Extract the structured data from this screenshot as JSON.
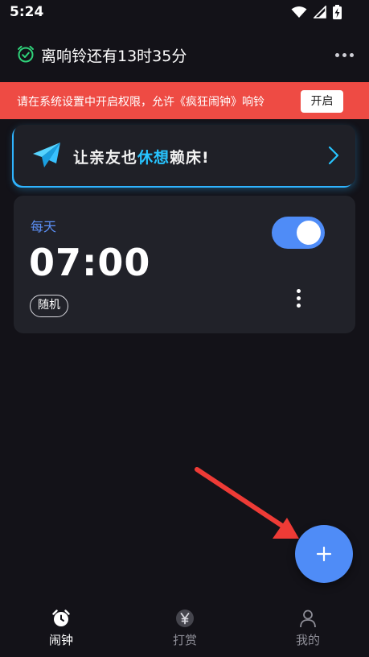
{
  "status_bar": {
    "time": "5:24",
    "icons": [
      "wifi-icon",
      "signal-icon",
      "battery-charging-icon"
    ]
  },
  "header": {
    "title": "离响铃还有13时35分",
    "icon": "alarm-check-icon",
    "accent": "#2fd27a"
  },
  "permission_banner": {
    "text": "请在系统设置中开启权限，允许《疯狂闹钟》响铃",
    "button": "开启",
    "background": "#ee4b44"
  },
  "promo": {
    "text_part1": "让亲友也",
    "text_part2": "休想",
    "text_part3": "赖床!",
    "icon": "paper-plane-icon",
    "accent": "#27c4ff"
  },
  "alarm": {
    "repeat": "每天",
    "time": "07:00",
    "mode": "随机",
    "enabled": true,
    "toggle_color": "#4f8cf7"
  },
  "fab": {
    "icon": "plus-icon",
    "color": "#4f8cf7"
  },
  "bottom_nav": {
    "items": [
      {
        "label": "闹钟",
        "icon": "alarm-clock-icon",
        "active": true
      },
      {
        "label": "打赏",
        "icon": "yen-coin-icon",
        "active": false
      },
      {
        "label": "我的",
        "icon": "person-icon",
        "active": false
      }
    ]
  }
}
